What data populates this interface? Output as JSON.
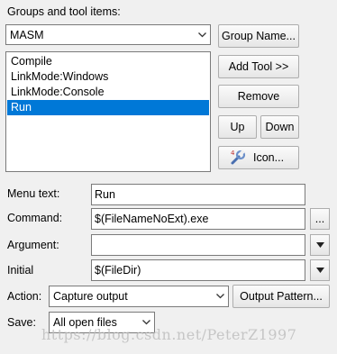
{
  "group_label": "Groups and tool items:",
  "group_select": {
    "value": "MASM"
  },
  "tool_list": {
    "items": [
      {
        "label": "Compile"
      },
      {
        "label": "LinkMode:Windows"
      },
      {
        "label": "LinkMode:Console"
      },
      {
        "label": "Run"
      }
    ],
    "selected": "Run"
  },
  "buttons": {
    "group_name": "Group Name...",
    "add_tool": "Add Tool >>",
    "remove": "Remove",
    "up": "Up",
    "down": "Down",
    "icon": "Icon...",
    "output_pattern": "Output Pattern...",
    "browse": "..."
  },
  "form": {
    "menu_text": {
      "label": "Menu text:",
      "value": "Run"
    },
    "command": {
      "label": "Command:",
      "value": "$(FileNameNoExt).exe"
    },
    "argument": {
      "label": "Argument:",
      "value": ""
    },
    "initial": {
      "label": "Initial",
      "value": "$(FileDir)"
    },
    "action": {
      "label": "Action:",
      "value": "Capture output"
    },
    "save": {
      "label": "Save:",
      "value": "All open files"
    }
  },
  "watermark": "https://blog.csdn.net/PeterZ1997",
  "icons": [
    "chevron-down-icon",
    "wrench-icon"
  ]
}
